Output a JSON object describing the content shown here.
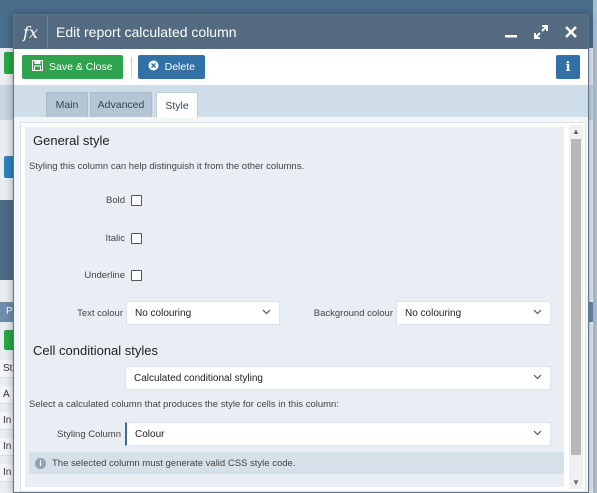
{
  "dialog": {
    "title": "Edit report calculated column",
    "fx_symbol": "fx"
  },
  "toolbar": {
    "save_close_label": "Save & Close",
    "delete_label": "Delete"
  },
  "tabs": [
    {
      "label": "Main",
      "active": false
    },
    {
      "label": "Advanced",
      "active": false
    },
    {
      "label": "Style",
      "active": true
    }
  ],
  "general_style": {
    "heading": "General style",
    "description": "Styling this column can help distinguish it from the other columns.",
    "bold_label": "Bold",
    "bold_checked": false,
    "italic_label": "Italic",
    "italic_checked": false,
    "underline_label": "Underline",
    "underline_checked": false,
    "text_colour_label": "Text colour",
    "text_colour_value": "No colouring",
    "background_colour_label": "Background colour",
    "background_colour_value": "No colouring"
  },
  "cell_conditional": {
    "heading": "Cell conditional styles",
    "mode_value": "Calculated conditional styling",
    "description": "Select a calculated column that produces the style for cells in this column:",
    "styling_column_label": "Styling Column",
    "styling_column_value": "Colour",
    "note": "The selected column must generate valid CSS style code."
  },
  "background_app": {
    "row_letters": [
      "Pr",
      "St",
      "A",
      "In",
      "In",
      "In"
    ]
  },
  "colors": {
    "titlebar": "#536a80",
    "save_green": "#2ea44f",
    "action_blue": "#3271a8",
    "tabbar": "#cfdde9",
    "pane": "#e8eef4"
  }
}
